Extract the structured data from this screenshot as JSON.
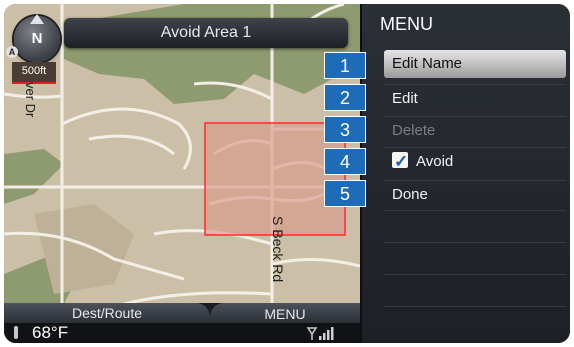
{
  "map": {
    "title": "Avoid Area 1",
    "compass_label": "N",
    "scale_label": "500ft",
    "street_left": "ver Dr",
    "street_main": "S Beck Rd",
    "colors": {
      "land": "#ccbfa7",
      "park": "#8e9a6f",
      "road": "#f4efe6",
      "avoid_fill": "#d9988a",
      "avoid_border": "#ff2a2a"
    }
  },
  "menu": {
    "title": "MENU",
    "items": [
      {
        "label": "Edit Name",
        "state": "selected"
      },
      {
        "label": "Edit",
        "state": "normal"
      },
      {
        "label": "Delete",
        "state": "disabled"
      },
      {
        "label": "Avoid",
        "state": "checked"
      },
      {
        "label": "Done",
        "state": "normal"
      }
    ]
  },
  "callouts": [
    "1",
    "2",
    "3",
    "4",
    "5"
  ],
  "bottom": {
    "dest_label": "Dest/Route",
    "menu_label": "MENU",
    "temperature": "68°F"
  },
  "icons": [
    "compass-icon",
    "checkbox-icon",
    "thermometer-icon",
    "signal-icon"
  ]
}
